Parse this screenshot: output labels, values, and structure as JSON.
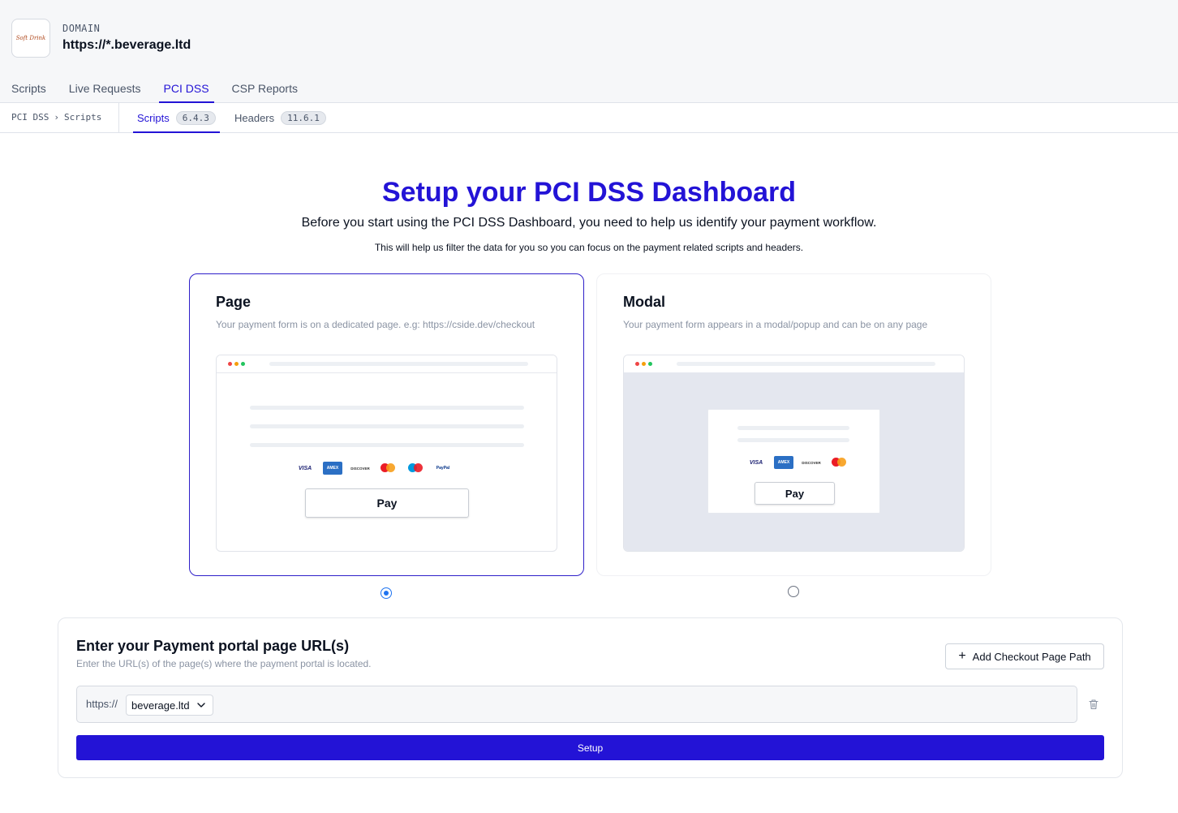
{
  "header": {
    "logo_text": "Soft Drink",
    "domain_label": "DOMAIN",
    "domain_value": "https://*.beverage.ltd",
    "tabs": [
      {
        "label": "Scripts"
      },
      {
        "label": "Live Requests"
      },
      {
        "label": "PCI DSS",
        "active": true
      },
      {
        "label": "CSP Reports"
      }
    ]
  },
  "subnav": {
    "breadcrumb": [
      "PCI DSS",
      "›",
      "Scripts"
    ],
    "tabs": [
      {
        "label": "Scripts",
        "badge": "6.4.3",
        "active": true
      },
      {
        "label": "Headers",
        "badge": "11.6.1"
      }
    ]
  },
  "hero": {
    "title": "Setup your PCI DSS Dashboard",
    "subtitle": "Before you start using the PCI DSS Dashboard, you need to help us identify your payment workflow.",
    "note": "This will help us filter the data for you so you can focus on the payment related scripts and headers."
  },
  "options": {
    "page": {
      "title": "Page",
      "description": "Your payment form is on a dedicated page. e.g: https://cside.dev/checkout",
      "pay_label": "Pay",
      "cards": [
        "VISA",
        "AMEX",
        "DISCOVER",
        "Mastercard",
        "Maestro",
        "PayPal"
      ],
      "selected": true
    },
    "modal": {
      "title": "Modal",
      "description": "Your payment form appears in a modal/popup and can be on any page",
      "pay_label": "Pay",
      "cards": [
        "VISA",
        "AMEX",
        "DISCOVER",
        "Mastercard"
      ],
      "selected": false
    }
  },
  "url_panel": {
    "title": "Enter your Payment portal page URL(s)",
    "description": "Enter the URL(s) of the page(s) where the payment portal is located.",
    "add_button": "Add Checkout Page Path",
    "url_prefix": "https://",
    "domain_select": "beverage.ltd",
    "path_value": "",
    "setup_button": "Setup"
  },
  "colors": {
    "accent": "#2313d6",
    "radio": "#1f73f0"
  }
}
